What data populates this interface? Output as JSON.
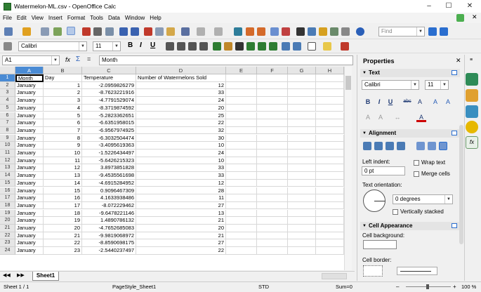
{
  "window": {
    "title": "Watermelon-ML.csv - OpenOffice Calc"
  },
  "menu": [
    "File",
    "Edit",
    "View",
    "Insert",
    "Format",
    "Tools",
    "Data",
    "Window",
    "Help"
  ],
  "find": {
    "placeholder": "Find"
  },
  "font": {
    "name": "Calibri",
    "size": "11"
  },
  "formula": {
    "namebox": "A1",
    "content": "Month"
  },
  "columns": [
    "A",
    "B",
    "C",
    "D",
    "E",
    "F",
    "G",
    "H",
    "I"
  ],
  "table": {
    "header": [
      "Month",
      "Day",
      "Temperature",
      "Number of Watermelons Sold"
    ],
    "rows": [
      [
        "January",
        "1",
        "-2.0959826279",
        "12"
      ],
      [
        "January",
        "2",
        "-8.7623221916",
        "33"
      ],
      [
        "January",
        "3",
        "-4.7791529074",
        "24"
      ],
      [
        "January",
        "4",
        "-8.3719874592",
        "20"
      ],
      [
        "January",
        "5",
        "-5.2823362651",
        "25"
      ],
      [
        "January",
        "6",
        "-6.6351958015",
        "22"
      ],
      [
        "January",
        "7",
        "-6.9567974925",
        "32"
      ],
      [
        "January",
        "8",
        "-6.3032504474",
        "30"
      ],
      [
        "January",
        "9",
        "-3.4095619363",
        "10"
      ],
      [
        "January",
        "10",
        "-1.5226434497",
        "24"
      ],
      [
        "January",
        "11",
        "-5.6426215323",
        "10"
      ],
      [
        "January",
        "12",
        "3.8973851828",
        "33"
      ],
      [
        "January",
        "13",
        "-9.4535561698",
        "33"
      ],
      [
        "January",
        "14",
        "-4.6915284952",
        "12"
      ],
      [
        "January",
        "15",
        "0.9096467309",
        "28"
      ],
      [
        "January",
        "16",
        "4.1633938486",
        "11"
      ],
      [
        "January",
        "17",
        "-8.072229462",
        "27"
      ],
      [
        "January",
        "18",
        "-9.6478221146",
        "13"
      ],
      [
        "January",
        "19",
        "1.4890786132",
        "21"
      ],
      [
        "January",
        "20",
        "-4.7652685083",
        "20"
      ],
      [
        "January",
        "21",
        "-9.9819068972",
        "21"
      ],
      [
        "January",
        "22",
        "-8.8590698175",
        "27"
      ],
      [
        "January",
        "23",
        "-2.5440237497",
        "22"
      ]
    ]
  },
  "sheets": {
    "tab": "Sheet1"
  },
  "status": {
    "sheet": "Sheet 1 / 1",
    "pagestyle": "PageStyle_Sheet1",
    "mode": "STD",
    "sum": "Sum=0",
    "zoom": "100 %"
  },
  "sidebar": {
    "title": "Properties",
    "text": {
      "header": "Text",
      "font": "Calibri",
      "size": "11"
    },
    "alignment": {
      "header": "Alignment",
      "left_indent_label": "Left indent:",
      "left_indent_value": "0 pt",
      "wrap": "Wrap text",
      "merge": "Merge cells",
      "orientation_label": "Text orientation:",
      "degrees": "0 degrees",
      "stacked": "Vertically stacked"
    },
    "cell_appearance": {
      "header": "Cell Appearance",
      "background_label": "Cell background:",
      "border_label": "Cell border:"
    }
  }
}
